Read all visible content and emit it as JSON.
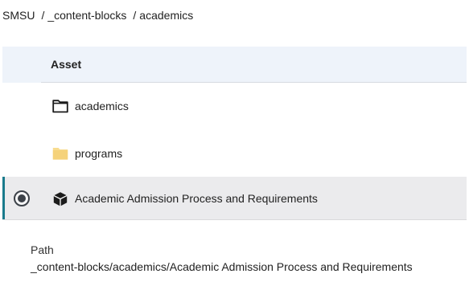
{
  "breadcrumb": {
    "items": [
      "SMSU",
      "_content-blocks",
      "academics"
    ],
    "separator": "/"
  },
  "table": {
    "column_header": "Asset",
    "rows": [
      {
        "label": "academics",
        "icon": "folder-outline-icon",
        "selected": false
      },
      {
        "label": "programs",
        "icon": "folder-filled-icon",
        "selected": false
      },
      {
        "label": "Academic Admission Process and Requirements",
        "icon": "block-cube-icon",
        "selected": true
      }
    ]
  },
  "path": {
    "label": "Path",
    "value": "_content-blocks/academics/Academic Admission Process and Requirements"
  },
  "colors": {
    "header_bg": "#eef3fa",
    "selected_bg": "#ebebed",
    "accent": "#197a8c",
    "folder_fill": "#f8dc8f"
  }
}
